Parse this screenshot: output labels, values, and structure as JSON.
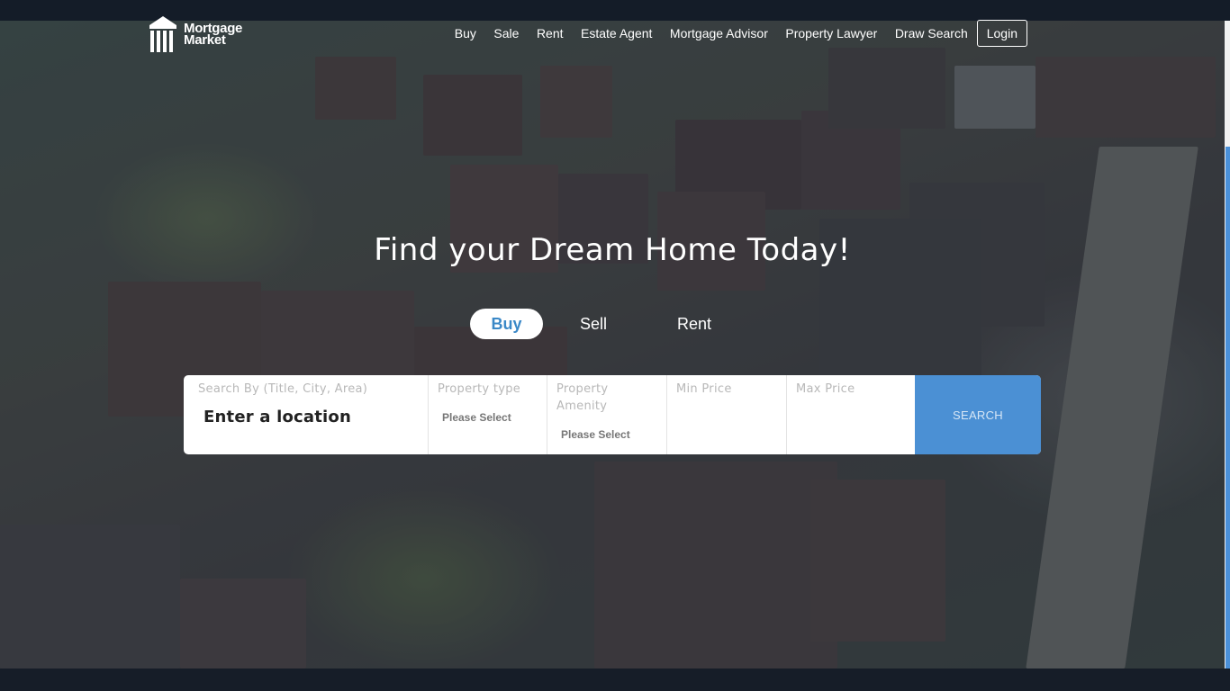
{
  "brand": {
    "line1": "Mortgage",
    "line2": "Market"
  },
  "nav": {
    "items": [
      "Buy",
      "Sale",
      "Rent",
      "Estate Agent",
      "Mortgage Advisor",
      "Property Lawyer",
      "Draw Search"
    ],
    "login": "Login"
  },
  "hero": {
    "title": "Find your Dream Home Today!",
    "tabs": [
      "Buy",
      "Sell",
      "Rent"
    ],
    "active_tab": "Buy"
  },
  "search": {
    "location_label": "Search By (Title, City, Area)",
    "location_value": "Enter a location",
    "property_type_label": "Property type",
    "property_type_value": "Please Select",
    "amenity_label": "Property Amenity",
    "amenity_value": "Please Select",
    "min_price_label": "Min Price",
    "max_price_label": "Max Price",
    "button": "SEARCH"
  },
  "colors": {
    "accent": "#4b90d4",
    "dark": "#141c28",
    "text_white": "#ffffff"
  }
}
